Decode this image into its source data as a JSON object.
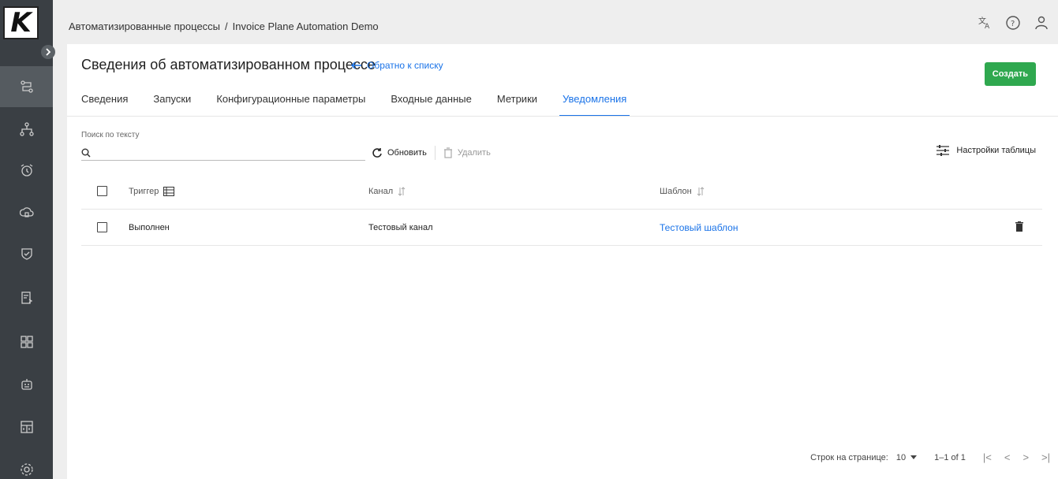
{
  "app": {
    "logo_letter": "K"
  },
  "header": {
    "breadcrumb_parent": "Автоматизированные процессы",
    "breadcrumb_sep": "/",
    "breadcrumb_current": "Invoice Plane Automation Demo"
  },
  "page": {
    "title": "Сведения об автоматизированном процессе",
    "back_link": "Обратно к списку",
    "create_label": "Создать"
  },
  "tabs": [
    {
      "label": "Сведения"
    },
    {
      "label": "Запуски"
    },
    {
      "label": "Конфигурационные параметры"
    },
    {
      "label": "Входные данные"
    },
    {
      "label": "Метрики"
    },
    {
      "label": "Уведомления"
    }
  ],
  "active_tab": "Уведомления",
  "search": {
    "label": "Поиск по тексту",
    "value": ""
  },
  "toolbar": {
    "refresh": "Обновить",
    "delete": "Удалить",
    "table_settings": "Настройки таблицы"
  },
  "table": {
    "columns": [
      "Триггер",
      "Канал",
      "Шаблон"
    ],
    "rows": [
      {
        "trigger": "Выполнен",
        "channel": "Тестовый канал",
        "template": "Тестовый шаблон"
      }
    ]
  },
  "pagination": {
    "rows_label": "Строк на странице:",
    "rows_value": "10",
    "range": "1–1 of 1"
  },
  "colors": {
    "accent": "#1a73e8",
    "create": "#2fa84f",
    "sidebar": "#3a3f44"
  }
}
